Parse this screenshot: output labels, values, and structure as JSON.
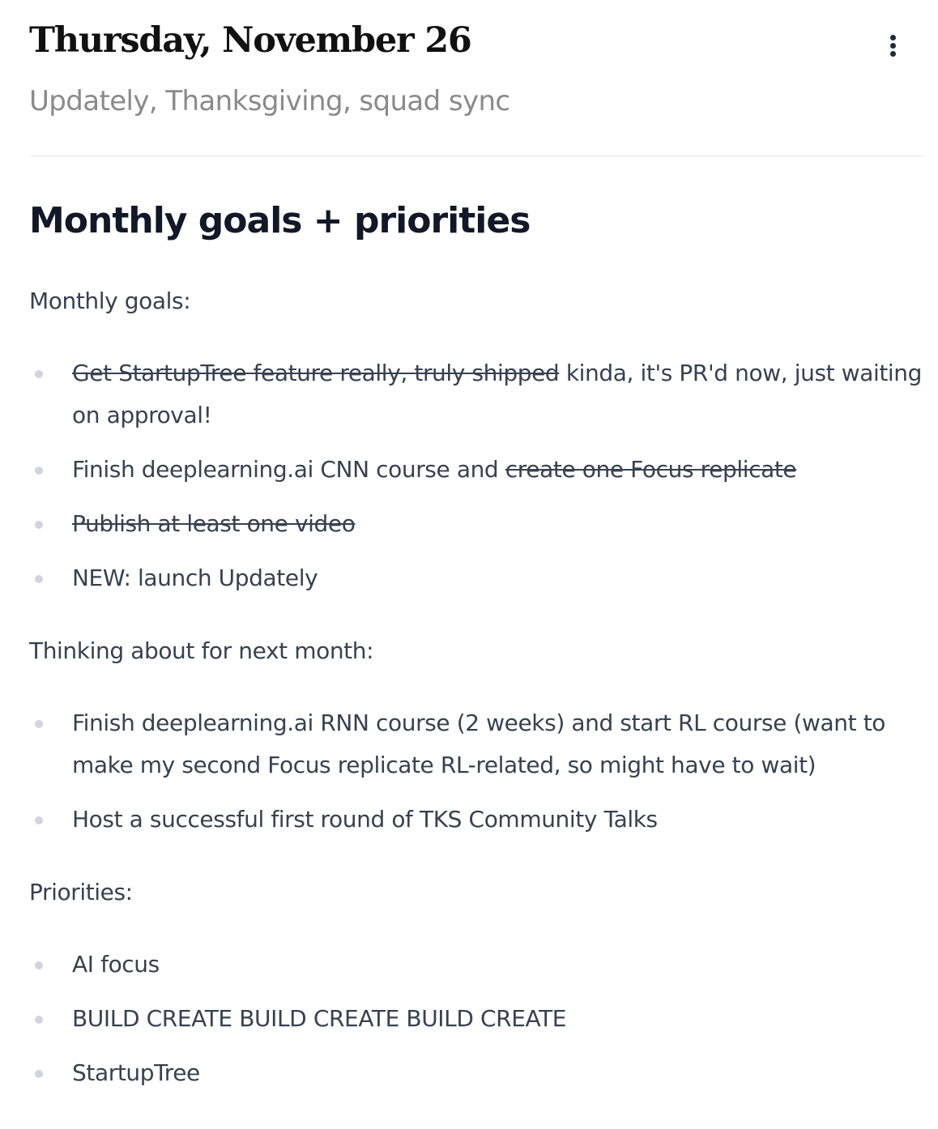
{
  "header": {
    "title": "Thursday, November 26",
    "subtitle": "Updately, Thanksgiving, squad sync",
    "menu_icon": "more-vertical-icon"
  },
  "section": {
    "heading": "Monthly goals + priorities"
  },
  "monthly_goals": {
    "label": "Monthly goals:",
    "items": [
      {
        "struck": "Get StartupTree feature really, truly shipped",
        "text": " kinda, it's PR'd now, just waiting on approval!"
      },
      {
        "text": "Finish deeplearning.ai CNN course and ",
        "struck": "create one Focus replicate"
      },
      {
        "struck": "Publish at least one video"
      },
      {
        "text": "NEW: launch Updately"
      }
    ]
  },
  "next_month": {
    "label": "Thinking about for next month:",
    "items": [
      {
        "text": "Finish deeplearning.ai RNN course (2 weeks) and start RL course (want to make my second Focus replicate RL-related, so might have to wait)"
      },
      {
        "text": "Host a successful first round of TKS Community Talks"
      }
    ]
  },
  "priorities": {
    "label": "Priorities:",
    "items": [
      {
        "text": "AI focus"
      },
      {
        "text": "BUILD CREATE BUILD CREATE BUILD CREATE"
      },
      {
        "text": "StartupTree"
      }
    ]
  }
}
